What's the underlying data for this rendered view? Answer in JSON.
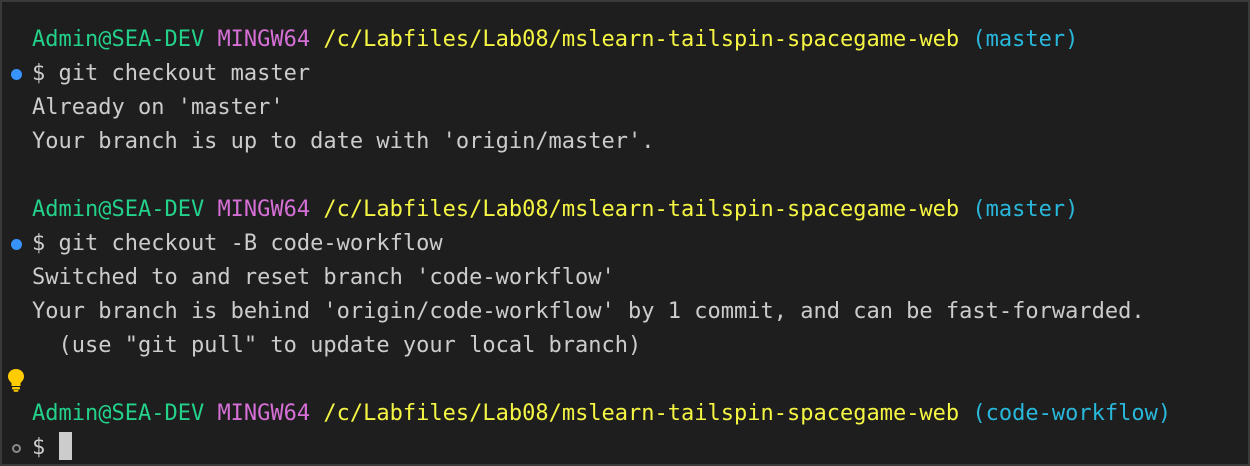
{
  "terminal": {
    "blocks": [
      {
        "prompt": {
          "user_host": "Admin@SEA-DEV",
          "system": "MINGW64",
          "path": "/c/Labfiles/Lab08/mslearn-tailspin-spacegame-web",
          "branch": "(master)"
        },
        "command": "$ git checkout master",
        "output": [
          "Already on 'master'",
          "Your branch is up to date with 'origin/master'."
        ]
      },
      {
        "prompt": {
          "user_host": "Admin@SEA-DEV",
          "system": "MINGW64",
          "path": "/c/Labfiles/Lab08/mslearn-tailspin-spacegame-web",
          "branch": "(master)"
        },
        "command": "$ git checkout -B code-workflow",
        "output": [
          "Switched to and reset branch 'code-workflow'",
          "Your branch is behind 'origin/code-workflow' by 1 commit, and can be fast-forwarded.",
          "  (use \"git pull\" to update your local branch)"
        ]
      },
      {
        "prompt": {
          "user_host": "Admin@SEA-DEV",
          "system": "MINGW64",
          "path": "/c/Labfiles/Lab08/mslearn-tailspin-spacegame-web",
          "branch": "(code-workflow)"
        },
        "command": "$ "
      }
    ]
  },
  "colors": {
    "background": "#1e1e1e",
    "user_host": "#23d18b",
    "system": "#d670d6",
    "path": "#f5f543",
    "branch": "#29b8db",
    "text": "#cccccc",
    "decoration_success": "#3794ff",
    "lightbulb": "#ffcc00"
  },
  "icons": {
    "command_success": "filled-circle",
    "command_pending": "hollow-circle",
    "quick_fix": "lightbulb"
  }
}
